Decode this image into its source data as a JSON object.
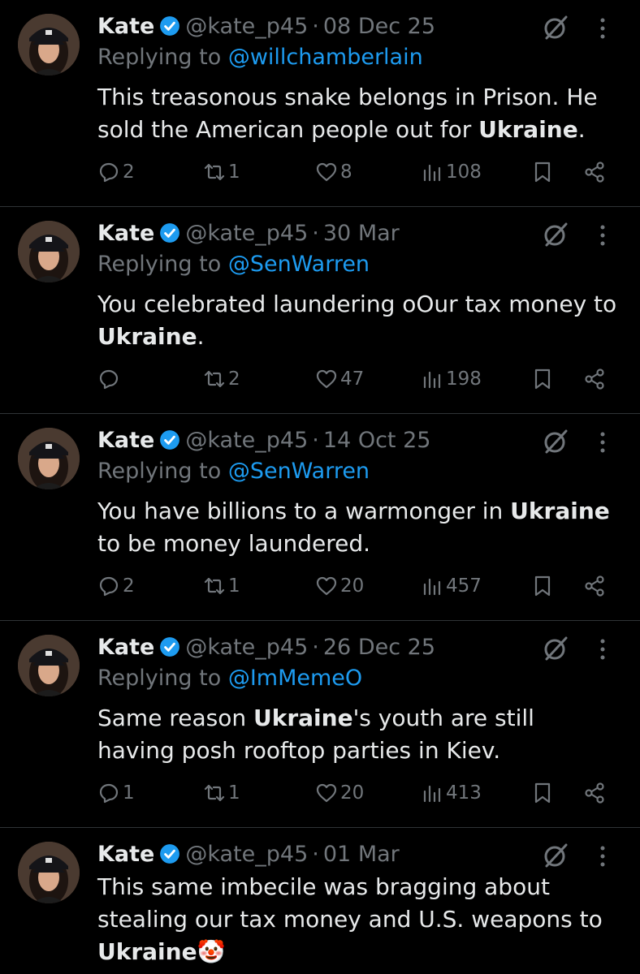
{
  "tweets": [
    {
      "name": "Kate",
      "handle": "@kate_p45",
      "separator": "·",
      "date": "08 Dec 25",
      "replying_prefix": "Replying to ",
      "replying_to": "@willchamberlain",
      "text_parts": [
        "This treasonous snake belongs in Prison. He sold the American people out for ",
        "Ukraine",
        "."
      ],
      "replies": "2",
      "reposts": "1",
      "likes": "8",
      "views": "108"
    },
    {
      "name": "Kate",
      "handle": "@kate_p45",
      "separator": "·",
      "date": "30 Mar",
      "replying_prefix": "Replying to ",
      "replying_to": "@SenWarren",
      "text_parts": [
        "You celebrated laundering oOur tax money to ",
        "Ukraine",
        "."
      ],
      "replies": "",
      "reposts": "2",
      "likes": "47",
      "views": "198"
    },
    {
      "name": "Kate",
      "handle": "@kate_p45",
      "separator": "·",
      "date": "14 Oct 25",
      "replying_prefix": "Replying to ",
      "replying_to": "@SenWarren",
      "text_parts": [
        "You have billions to a warmonger in ",
        "Ukraine",
        " to be money laundered."
      ],
      "replies": "2",
      "reposts": "1",
      "likes": "20",
      "views": "457"
    },
    {
      "name": "Kate",
      "handle": "@kate_p45",
      "separator": "·",
      "date": "26 Dec 25",
      "replying_prefix": "Replying to ",
      "replying_to": "@ImMemeO",
      "text_parts": [
        "Same reason ",
        "Ukraine",
        "'s youth are still having posh rooftop parties in Kiev."
      ],
      "replies": "1",
      "reposts": "1",
      "likes": "20",
      "views": "413"
    },
    {
      "name": "Kate",
      "handle": "@kate_p45",
      "separator": "·",
      "date": "01 Mar",
      "replying_prefix": "",
      "replying_to": "",
      "text_parts": [
        "This same imbecile was bragging about stealing our tax money and U.S. weapons to ",
        "Ukraine",
        "🤡"
      ],
      "replies": "",
      "reposts": "",
      "likes": "",
      "views": ""
    }
  ],
  "colors": {
    "background": "#000000",
    "text": "#e7e9ea",
    "secondary": "#71767b",
    "link": "#1d9bf0",
    "verified": "#1d9bf0",
    "divider": "#2f3336"
  },
  "icons": {
    "verified": "verified-badge-icon",
    "grok": "grok-icon",
    "more": "more-icon",
    "reply": "reply-icon",
    "repost": "repost-icon",
    "like": "like-icon",
    "views": "views-icon",
    "bookmark": "bookmark-icon",
    "share": "share-icon"
  }
}
